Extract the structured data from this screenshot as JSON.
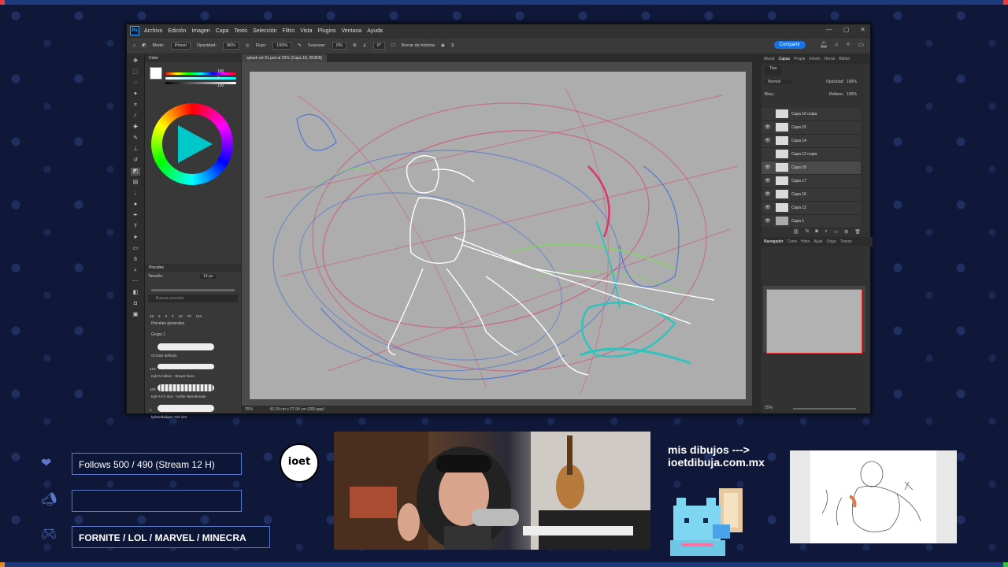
{
  "photoshop": {
    "menu": [
      "Archivo",
      "Edición",
      "Imagen",
      "Capa",
      "Texto",
      "Selección",
      "Filtro",
      "Vista",
      "Plugins",
      "Ventana",
      "Ayuda"
    ],
    "options": {
      "mode_label": "Modo:",
      "mode_value": "Pincel",
      "opacity_label": "Opacidad:",
      "opacity_value": "96%",
      "flow_label": "Flujo:",
      "flow_value": "100%",
      "smoothing_label": "Suavizar:",
      "smoothing_value": "0%",
      "angle_value": "0°",
      "history_label": "Borrar de historia",
      "share_label": "Compartir"
    },
    "document_tab": "splash art 01.psd al 25% (Capa 18, RGB/8)",
    "color_panel": {
      "title": "Color",
      "values": [
        "180",
        "0",
        "100"
      ]
    },
    "brush_panel": {
      "title": "Pinceles",
      "size_label": "Tamaño:",
      "size_value": "19 px",
      "search_placeholder": "Buscar pinceles",
      "preset_sizes": [
        "19",
        "6",
        "3",
        "3",
        "18",
        "70",
        "124"
      ],
      "groups": [
        "Pinceles generales",
        "Grupo 1"
      ],
      "brushes": [
        {
          "name": "Circular definido",
          "size": ""
        },
        {
          "name": "Kyle's Inkbox - Brayer Boss",
          "size": "413"
        },
        {
          "name": "Kyle's FX Box - Softer Wet Blender",
          "size": "100"
        },
        {
          "name": "kylesedadge1 722 ioet",
          "size": "1"
        }
      ]
    },
    "status": {
      "zoom": "25%",
      "dims": "43.18 cm x 27.94 cm (300 ppp)"
    },
    "right_tabs": [
      "Muest",
      "Capas",
      "Propie",
      "Inform",
      "Herrai",
      "Bibliot"
    ],
    "layers_panel": {
      "kind_label": "Tipo",
      "blend_mode": "Normal",
      "opacity_label": "Opacidad:",
      "opacity_value": "100%",
      "lock_label": "Bloq.:",
      "fill_label": "Relleno:",
      "fill_value": "100%",
      "layers": [
        {
          "name": "Capa 10 copia",
          "visible": false,
          "selected": false
        },
        {
          "name": "Capa 15",
          "visible": true,
          "selected": false
        },
        {
          "name": "Capa 14",
          "visible": true,
          "selected": false
        },
        {
          "name": "Capa 12 copia",
          "visible": false,
          "selected": false
        },
        {
          "name": "Capa 18",
          "visible": true,
          "selected": true
        },
        {
          "name": "Capa 17",
          "visible": true,
          "selected": false
        },
        {
          "name": "Capa 16",
          "visible": true,
          "selected": false
        },
        {
          "name": "Capa 12",
          "visible": true,
          "selected": false
        },
        {
          "name": "Capa 1",
          "visible": true,
          "selected": false
        }
      ]
    },
    "navigator_tabs": [
      "Navegador",
      "Corre",
      "Histo",
      "Ajust",
      "Orige",
      "Trazos"
    ],
    "navigator_zoom": "25%"
  },
  "overlay": {
    "follows": "Follows 500 / 490 (Stream 12 H)",
    "blank_box": "",
    "games": "FORNITE / LOL / MARVEL / MINECRA",
    "logo_text": "ioet",
    "promo_line1": "mis dibujos --->",
    "promo_line2": "ioetdibuja.com.mx"
  },
  "colors": {
    "accent_blue": "#1473e6",
    "stream_frame": "#1c3a7a",
    "stroke_red": "#e0245e",
    "stroke_blue": "#3f6fd8",
    "stroke_cyan": "#19c9c0",
    "stroke_green": "#7ed957"
  }
}
